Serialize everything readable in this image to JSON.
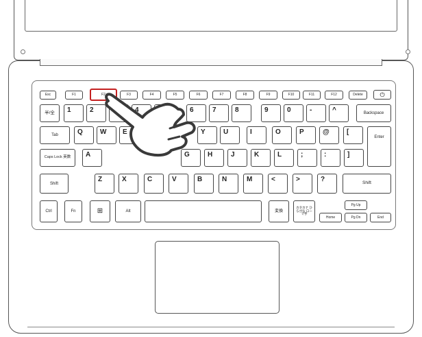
{
  "keyboard": {
    "fn_row": [
      "Esc",
      "F1",
      "F2",
      "F3",
      "F4",
      "F5",
      "F6",
      "F7",
      "F8",
      "F9",
      "F10",
      "F11",
      "F12",
      "Delete",
      "⏻"
    ],
    "num_row": [
      "半/全",
      "1",
      "2",
      "3",
      "4",
      "5",
      "6",
      "7",
      "8",
      "9",
      "0",
      "-",
      "^",
      "¥",
      "Backspace"
    ],
    "q_row": [
      "Tab",
      "Q",
      "W",
      "E",
      "R",
      "T",
      "Y",
      "U",
      "I",
      "O",
      "P",
      "@",
      "[",
      "Enter"
    ],
    "a_row": [
      "Caps Lock 英数",
      "A",
      "S",
      "D",
      "F",
      "G",
      "H",
      "J",
      "K",
      "L",
      ";",
      ":",
      "]"
    ],
    "z_row": [
      "Shift",
      "Z",
      "X",
      "C",
      "V",
      "B",
      "N",
      "M",
      "<",
      ">",
      "?",
      "\\",
      "Shift"
    ],
    "bottom_row": [
      "Ctrl",
      "Fn",
      "⊞",
      "Alt",
      "",
      "変換",
      "カタカナ ひらがな ローマ字",
      "Pg Up",
      "Home",
      "Pg Dn",
      "End"
    ],
    "highlighted_key": "F2"
  },
  "colors": {
    "highlight": "#c42020",
    "line": "#444444",
    "hand_fill": "#ffffff"
  },
  "icons": {
    "hand": "pointing-hand-icon",
    "power": "power-icon",
    "windows": "windows-icon"
  }
}
